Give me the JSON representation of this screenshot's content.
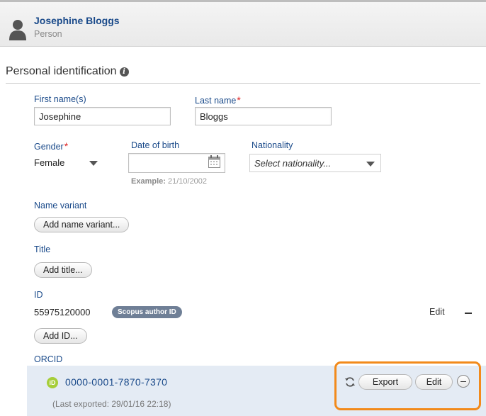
{
  "header": {
    "name": "Josephine Bloggs",
    "type": "Person"
  },
  "section": {
    "title": "Personal identification",
    "info_icon": "info-icon"
  },
  "fields": {
    "first_name": {
      "label": "First name(s)",
      "value": "Josephine"
    },
    "last_name": {
      "label": "Last name",
      "required_mark": "*",
      "value": "Bloggs"
    },
    "gender": {
      "label": "Gender",
      "required_mark": "*",
      "value": "Female"
    },
    "date_of_birth": {
      "label": "Date of birth",
      "value": "",
      "example_label": "Example:",
      "example_value": "21/10/2002"
    },
    "nationality": {
      "label": "Nationality",
      "placeholder": "Select nationality..."
    }
  },
  "name_variant": {
    "label": "Name variant",
    "button": "Add name variant..."
  },
  "title": {
    "label": "Title",
    "button": "Add title..."
  },
  "id": {
    "label": "ID",
    "value": "55975120000",
    "badge": "Scopus author ID",
    "edit": "Edit",
    "button": "Add ID..."
  },
  "orcid": {
    "label": "ORCID",
    "logo_text": "iD",
    "value": "0000-0001-7870-7370",
    "last_exported": "(Last exported: 29/01/16 22:18)",
    "export_button": "Export",
    "edit_button": "Edit"
  },
  "colors": {
    "link": "#1a4a8a",
    "required": "#dd2222",
    "highlight": "#f28a1b",
    "orcid_green": "#a6ce39",
    "orcid_bg": "#e4ebf4"
  }
}
